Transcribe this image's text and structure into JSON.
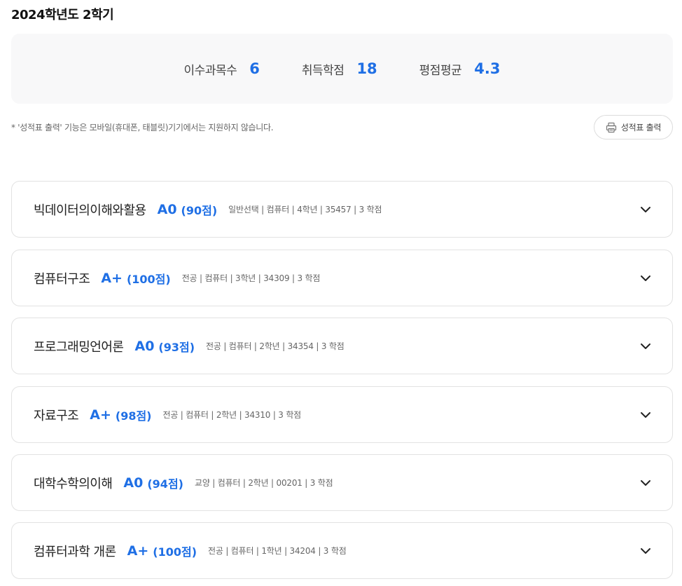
{
  "term": {
    "title": "2024학년도 2학기"
  },
  "summary": {
    "stats": [
      {
        "label": "이수과목수",
        "value": "6"
      },
      {
        "label": "취득학점",
        "value": "18"
      },
      {
        "label": "평점평균",
        "value": "4.3"
      }
    ]
  },
  "notice": "* '성적표 출력' 기능은 모바일(휴대폰, 태블릿)기기에서는 지원하지 않습니다.",
  "print_button": {
    "label": "성적표 출력",
    "icon": "printer-icon"
  },
  "courses": [
    {
      "name": "빅데이터의이해와활용",
      "grade": "A0",
      "score": "(90점)",
      "meta": "일반선택 | 컴퓨터 | 4학년 | 35457 | 3 학점"
    },
    {
      "name": "컴퓨터구조",
      "grade": "A+",
      "score": "(100점)",
      "meta": "전공 | 컴퓨터 | 3학년 | 34309 | 3 학점"
    },
    {
      "name": "프로그래밍언어론",
      "grade": "A0",
      "score": "(93점)",
      "meta": "전공 | 컴퓨터 | 2학년 | 34354 | 3 학점"
    },
    {
      "name": "자료구조",
      "grade": "A+",
      "score": "(98점)",
      "meta": "전공 | 컴퓨터 | 2학년 | 34310 | 3 학점"
    },
    {
      "name": "대학수학의이해",
      "grade": "A0",
      "score": "(94점)",
      "meta": "교양 | 컴퓨터 | 2학년 | 00201 | 3 학점"
    },
    {
      "name": "컴퓨터과학 개론",
      "grade": "A+",
      "score": "(100점)",
      "meta": "전공 | 컴퓨터 | 1학년 | 34204 | 3 학점"
    }
  ],
  "colors": {
    "accent": "#1f6fe5",
    "summary_bg": "#f8f8f9",
    "border": "#e2e2e2"
  }
}
